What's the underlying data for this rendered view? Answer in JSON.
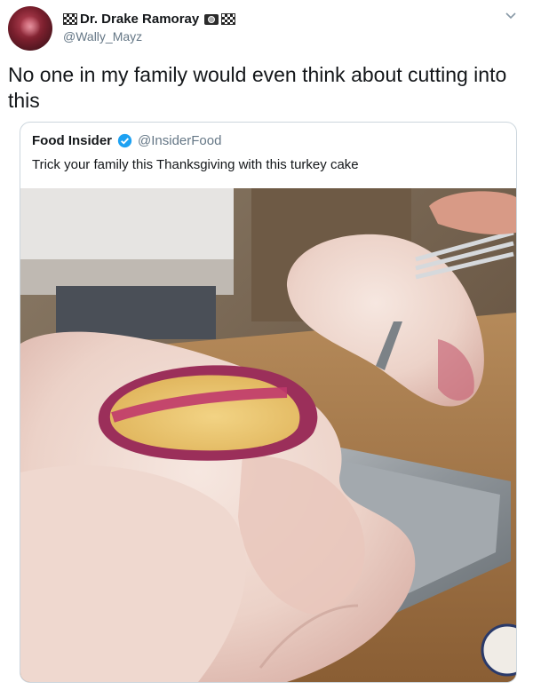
{
  "tweet": {
    "display_name": "Dr. Drake Ramoray",
    "handle": "@Wally_Mayz",
    "text": "No one in my family would even think about cutting into this",
    "icons": [
      "flag-icon",
      "camera-icon",
      "flag-icon",
      "chevron-down-icon"
    ]
  },
  "quoted_tweet": {
    "display_name": "Food Insider",
    "handle": "@InsiderFood",
    "verified": true,
    "text": "Trick your family this Thanksgiving with this turkey cake",
    "photo_subject": "turkey-shaped cake with a slice cut out, on a metal baking pan, fork holding the cut piece"
  },
  "colors": {
    "primary_text": "#14171a",
    "secondary_text": "#657786",
    "border": "#ccd6dd",
    "verified_blue": "#1da1f2"
  }
}
